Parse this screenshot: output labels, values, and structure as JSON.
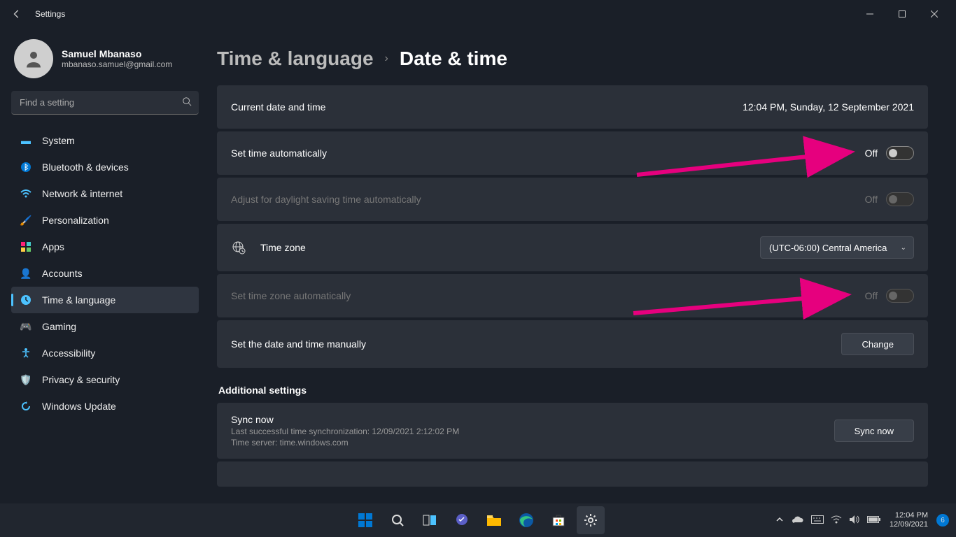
{
  "titlebar": {
    "title": "Settings"
  },
  "profile": {
    "name": "Samuel Mbanaso",
    "email": "mbanaso.samuel@gmail.com"
  },
  "search": {
    "placeholder": "Find a setting"
  },
  "nav": [
    {
      "label": "System",
      "icon": "🖥️"
    },
    {
      "label": "Bluetooth & devices",
      "icon": "bt"
    },
    {
      "label": "Network & internet",
      "icon": "wifi"
    },
    {
      "label": "Personalization",
      "icon": "🖌️"
    },
    {
      "label": "Apps",
      "icon": "apps"
    },
    {
      "label": "Accounts",
      "icon": "👤"
    },
    {
      "label": "Time & language",
      "icon": "🕘"
    },
    {
      "label": "Gaming",
      "icon": "🎮"
    },
    {
      "label": "Accessibility",
      "icon": "acc"
    },
    {
      "label": "Privacy & security",
      "icon": "🛡️"
    },
    {
      "label": "Windows Update",
      "icon": "↻"
    }
  ],
  "breadcrumb": {
    "parent": "Time & language",
    "current": "Date & time"
  },
  "rows": {
    "current": {
      "label": "Current date and time",
      "value": "12:04 PM, Sunday, 12 September 2021"
    },
    "autoTime": {
      "label": "Set time automatically",
      "state": "Off"
    },
    "dst": {
      "label": "Adjust for daylight saving time automatically",
      "state": "Off"
    },
    "tz": {
      "label": "Time zone",
      "value": "(UTC-06:00) Central America"
    },
    "autoTz": {
      "label": "Set time zone automatically",
      "state": "Off"
    },
    "manual": {
      "label": "Set the date and time manually",
      "button": "Change"
    }
  },
  "additional": {
    "title": "Additional settings",
    "sync": {
      "title": "Sync now",
      "line1": "Last successful time synchronization: 12/09/2021 2:12:02 PM",
      "line2": "Time server: time.windows.com",
      "button": "Sync now"
    }
  },
  "taskbar": {
    "clock": {
      "time": "12:04 PM",
      "date": "12/09/2021"
    },
    "badge": "6"
  }
}
